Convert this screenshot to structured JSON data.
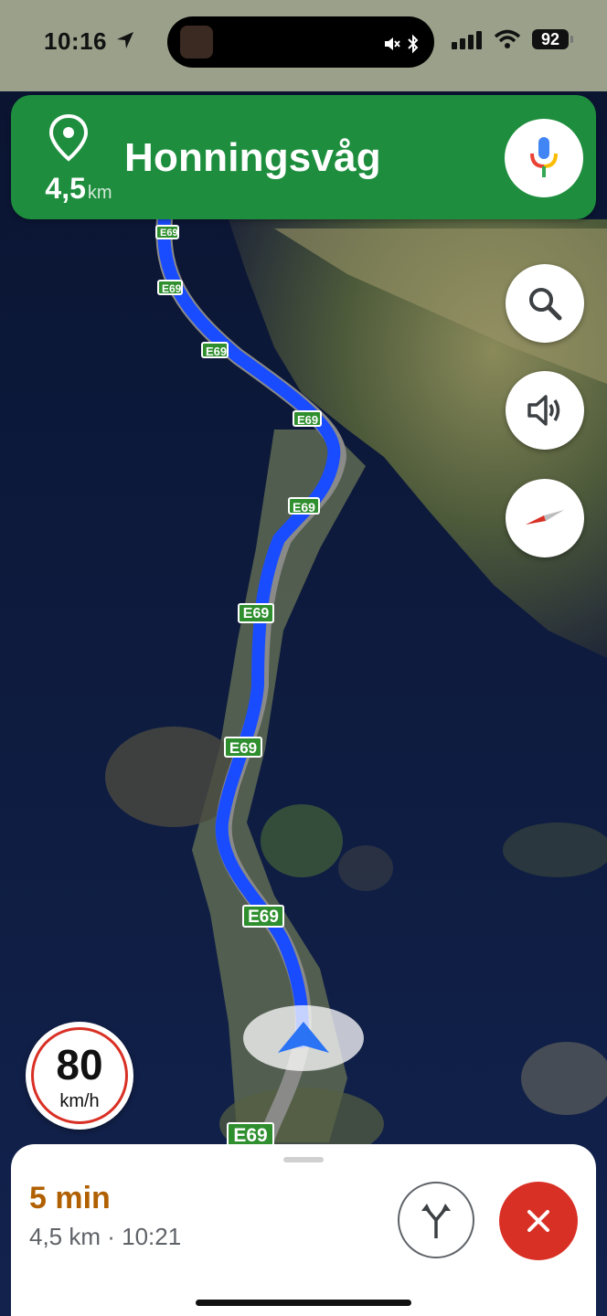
{
  "status_bar": {
    "time": "10:16",
    "battery": "92",
    "location_icon": "location-arrow-icon",
    "mute_icon": "mute-icon",
    "bluetooth_icon": "bluetooth-icon",
    "signal_icon": "signal-icon",
    "wifi_icon": "wifi-icon"
  },
  "navigation": {
    "destination": "Honningsvåg",
    "distance_value": "4,5",
    "distance_unit": "km",
    "pin_icon": "destination-pin-icon",
    "mic_icon": "mic-icon",
    "accent_color": "#1e8e3e"
  },
  "map": {
    "road_shields": [
      "E69",
      "E69",
      "E69",
      "E69",
      "E69",
      "E69",
      "E69",
      "E69",
      "E69"
    ],
    "route_color": "#1a4cff",
    "position_marker_icon": "navigation-arrow-icon"
  },
  "side_buttons": {
    "search_icon": "search-icon",
    "sound_icon": "speaker-icon",
    "compass_icon": "compass-icon"
  },
  "speed_limit": {
    "value": "80",
    "unit": "km/h"
  },
  "trip_sheet": {
    "eta_duration": "5 min",
    "eta_detail": "4,5 km · 10:21",
    "routes_icon": "alternate-routes-icon",
    "close_icon": "close-icon",
    "eta_color": "#b06000"
  }
}
